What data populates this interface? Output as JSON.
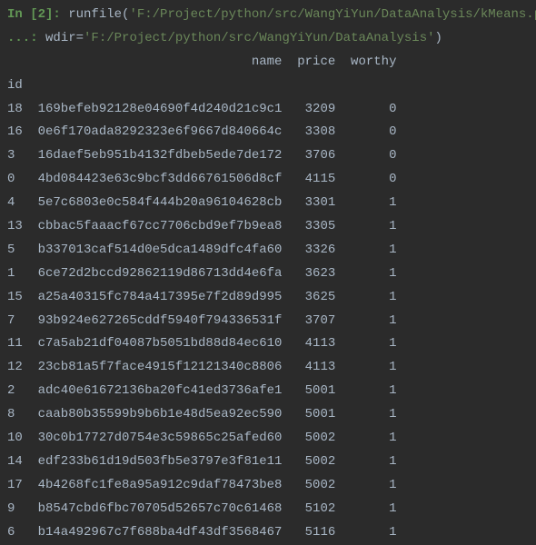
{
  "input_cell": {
    "prompt": "In [2]:",
    "func_call_prefix": " runfile(",
    "arg1": "'F:/Project/python/src/WangYiYun/DataAnalysis/kMeans.py'",
    "continuation": "   ...: ",
    "wdir_key": " wdir=",
    "wdir_val": "'F:/Project/python/src/WangYiYun/DataAnalysis'",
    "close": ")"
  },
  "output": {
    "header": "                                name  price  worthy",
    "id_label": "id",
    "rows": [
      {
        "id": "18",
        "name": "169befeb92128e04690f4d240d21c9c1",
        "price": "3209",
        "worthy": "0"
      },
      {
        "id": "16",
        "name": "0e6f170ada8292323e6f9667d840664c",
        "price": "3308",
        "worthy": "0"
      },
      {
        "id": "3",
        "name": "16daef5eb951b4132fdbeb5ede7de172",
        "price": "3706",
        "worthy": "0"
      },
      {
        "id": "0",
        "name": "4bd084423e63c9bcf3dd66761506d8cf",
        "price": "4115",
        "worthy": "0"
      },
      {
        "id": "4",
        "name": "5e7c6803e0c584f444b20a96104628cb",
        "price": "3301",
        "worthy": "1"
      },
      {
        "id": "13",
        "name": "cbbac5faaacf67cc7706cbd9ef7b9ea8",
        "price": "3305",
        "worthy": "1"
      },
      {
        "id": "5",
        "name": "b337013caf514d0e5dca1489dfc4fa60",
        "price": "3326",
        "worthy": "1"
      },
      {
        "id": "1",
        "name": "6ce72d2bccd92862119d86713dd4e6fa",
        "price": "3623",
        "worthy": "1"
      },
      {
        "id": "15",
        "name": "a25a40315fc784a417395e7f2d89d995",
        "price": "3625",
        "worthy": "1"
      },
      {
        "id": "7",
        "name": "93b924e627265cddf5940f794336531f",
        "price": "3707",
        "worthy": "1"
      },
      {
        "id": "11",
        "name": "c7a5ab21df04087b5051bd88d84ec610",
        "price": "4113",
        "worthy": "1"
      },
      {
        "id": "12",
        "name": "23cb81a5f7face4915f12121340c8806",
        "price": "4113",
        "worthy": "1"
      },
      {
        "id": "2",
        "name": "adc40e61672136ba20fc41ed3736afe1",
        "price": "5001",
        "worthy": "1"
      },
      {
        "id": "8",
        "name": "caab80b35599b9b6b1e48d5ea92ec590",
        "price": "5001",
        "worthy": "1"
      },
      {
        "id": "10",
        "name": "30c0b17727d0754e3c59865c25afed60",
        "price": "5002",
        "worthy": "1"
      },
      {
        "id": "14",
        "name": "edf233b61d19d503fb5e3797e3f81e11",
        "price": "5002",
        "worthy": "1"
      },
      {
        "id": "17",
        "name": "4b4268fc1fe8a95a912c9daf78473be8",
        "price": "5002",
        "worthy": "1"
      },
      {
        "id": "9",
        "name": "b8547cbd6fbc70705d52657c70c61468",
        "price": "5102",
        "worthy": "1"
      },
      {
        "id": "6",
        "name": "b14a492967c7f688ba4df43df3568467",
        "price": "5116",
        "worthy": "1"
      }
    ]
  }
}
